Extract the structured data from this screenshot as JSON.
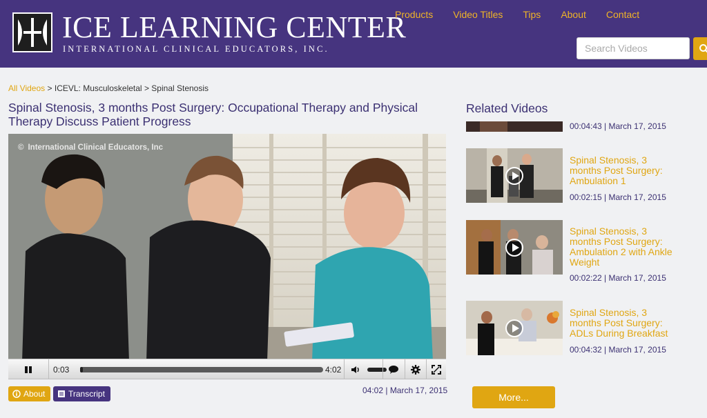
{
  "header": {
    "logo_title": "ICE LEARNING CENTER",
    "logo_subtitle": "INTERNATIONAL CLINICAL EDUCATORS, INC.",
    "nav": [
      "Products",
      "Video Titles",
      "Tips",
      "About",
      "Contact"
    ],
    "search_placeholder": "Search Videos"
  },
  "breadcrumb": {
    "items": [
      "All Videos",
      "ICEVL: Musculoskeletal",
      "Spinal Stenosis"
    ],
    "separator": ">"
  },
  "page_title": "Spinal Stenosis, 3 months Post Surgery: Occupational Therapy and Physical Therapy Discuss Patient Progress",
  "video": {
    "watermark": "International Clinical Educators, Inc",
    "current_time": "0:03",
    "duration": "4:02",
    "progress": 0.012
  },
  "video_actions": {
    "about_label": "About",
    "transcript_label": "Transcript"
  },
  "video_meta": "04:02 | March 17, 2015",
  "related": {
    "heading": "Related Videos",
    "items": [
      {
        "title": "",
        "meta": "00:04:43 | March 17, 2015"
      },
      {
        "title": "Spinal Stenosis, 3 months Post Surgery: Ambulation 1",
        "meta": "00:02:15 | March 17, 2015"
      },
      {
        "title": "Spinal Stenosis, 3 months Post Surgery: Ambulation 2 with Ankle Weight",
        "meta": "00:02:22 | March 17, 2015"
      },
      {
        "title": "Spinal Stenosis, 3 months Post Surgery: ADLs During Breakfast",
        "meta": "00:04:32 | March 17, 2015"
      }
    ],
    "more_label": "More..."
  },
  "colors": {
    "header_bg": "#46347f",
    "accent": "#e0a612",
    "title": "#3b3072"
  }
}
